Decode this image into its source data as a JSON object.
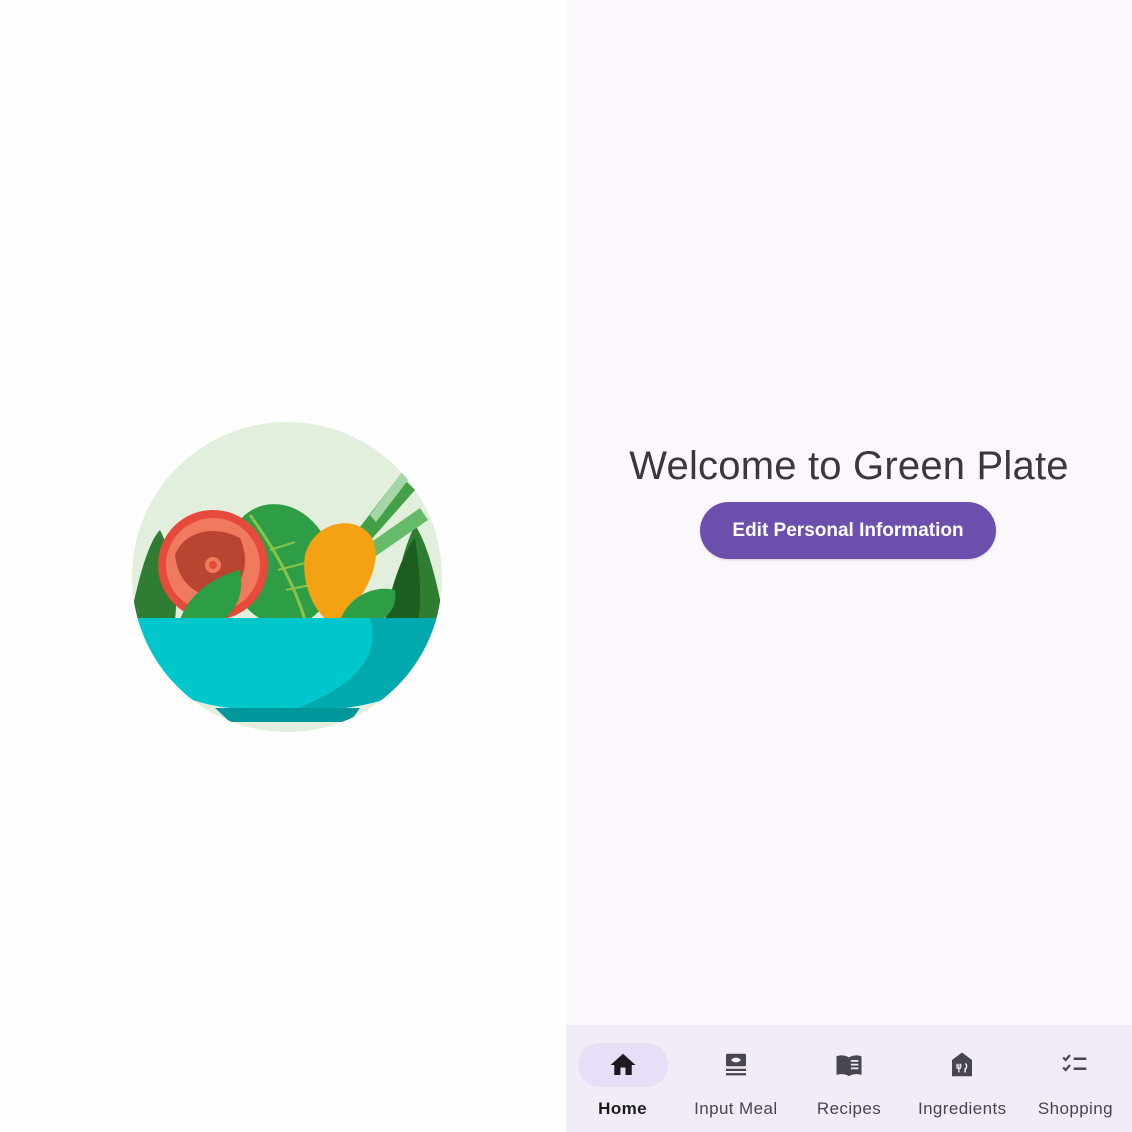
{
  "app": {
    "welcome_text": "Welcome to Green Plate",
    "edit_button_label": "Edit Personal Information"
  },
  "logo": {
    "icon": "salad-bowl-logo"
  },
  "bottom_nav": {
    "items": [
      {
        "label": "Home",
        "icon": "home-icon",
        "active": true
      },
      {
        "label": "Input Meal",
        "icon": "meal-input-icon",
        "active": false
      },
      {
        "label": "Recipes",
        "icon": "recipe-book-icon",
        "active": false
      },
      {
        "label": "Ingredients",
        "icon": "pantry-icon",
        "active": false
      },
      {
        "label": "Shopping",
        "icon": "checklist-icon",
        "active": false
      }
    ]
  },
  "colors": {
    "primary": "#6d4fae",
    "background": "#fcf6fd",
    "nav_background": "#f2ecf6",
    "nav_active_pill": "#e8def8"
  }
}
